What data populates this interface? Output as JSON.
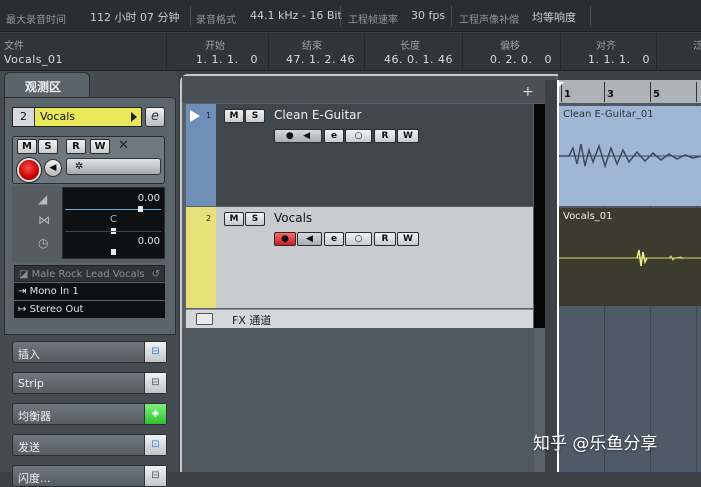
{
  "status_bar": {
    "max_record_time_label": "最大录音时间",
    "max_record_time_value": "112 小时 07 分钟",
    "record_format_label": "录音格式",
    "record_format_value": "44.1 kHz - 16 Bit",
    "frame_rate_label": "工程帧速率",
    "frame_rate_value": "30 fps",
    "pan_law_label": "工程声像补偿",
    "pan_law_value": "均等响度"
  },
  "info_line": {
    "file_label": "文件",
    "file_value": "Vocals_01",
    "start_label": "开始",
    "start_value": "1. 1. 1.   0",
    "end_label": "结束",
    "end_value": "47. 1. 2. 46",
    "length_label": "长度",
    "length_value": "46. 0. 1. 46",
    "offset_label": "偏移",
    "offset_value": "0. 2. 0.   0",
    "snap_label": "对齐",
    "snap_value": "1. 1. 1.   0",
    "extra_label": "泛"
  },
  "inspector": {
    "tab_label": "观测区",
    "track_number": "2",
    "track_name": "Vocals",
    "edit_glyph": "e",
    "m_label": "M",
    "s_label": "S",
    "r_label": "R",
    "w_label": "W",
    "lanes_glyph": "✲",
    "volume_value": "0.00",
    "pan_center": "C",
    "delay_value": "0.00",
    "preset": "Male Rock Lead Vocals",
    "input": "Mono In 1",
    "output": "Stereo Out",
    "sections": [
      {
        "label": "插入"
      },
      {
        "label": "Strip"
      },
      {
        "label": "均衡器"
      },
      {
        "label": "发送"
      },
      {
        "label": "闪度..."
      }
    ]
  },
  "tracks": [
    {
      "number": "1",
      "name": "Clean E-Guitar",
      "color": "#6f8fb8",
      "m": "M",
      "s": "S",
      "r": "R",
      "w": "W",
      "e": "e"
    },
    {
      "number": "2",
      "name": "Vocals",
      "color": "#e8e079",
      "m": "M",
      "s": "S",
      "r": "R",
      "w": "W",
      "e": "e"
    }
  ],
  "fx_channel_label": "FX 通道",
  "tracklist_add": "+",
  "ruler": [
    "1",
    "3",
    "5"
  ],
  "clips": [
    {
      "name": "Clean E-Guitar_01"
    },
    {
      "name": "Vocals_01"
    }
  ],
  "watermark": "知乎 @乐鱼分享",
  "colors": {
    "accent_yellow": "#e8e85a",
    "record_red": "#d10000",
    "eq_green": "#3fd53f",
    "guitar_clip": "#9fb7d4",
    "vocal_clip": "#3b3c2e"
  }
}
